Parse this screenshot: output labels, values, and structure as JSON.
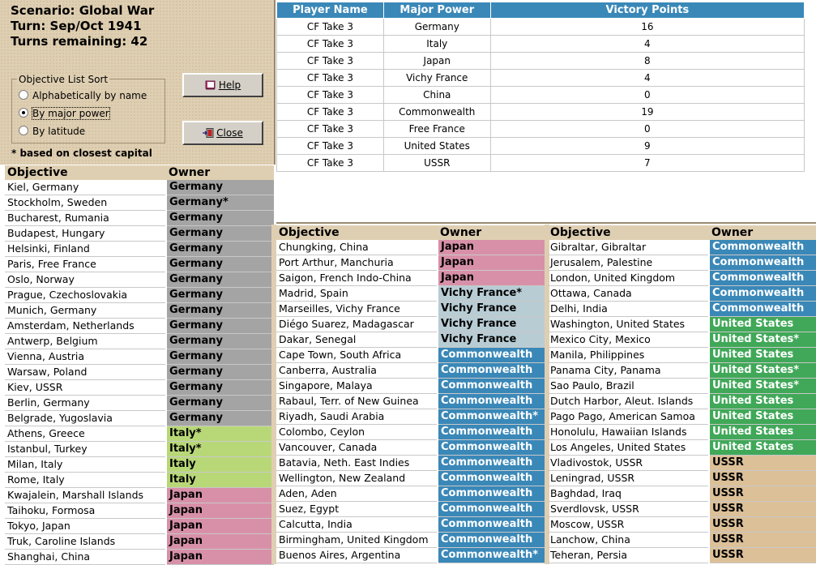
{
  "scenario": {
    "title": "Scenario: Global War",
    "turn": "Turn: Sep/Oct 1941",
    "remaining": "Turns remaining: 42"
  },
  "sort": {
    "legend": "Objective List Sort",
    "options": [
      "Alphabetically by name",
      "By major power",
      "By latitude"
    ],
    "selected": "By major power"
  },
  "buttons": {
    "help_label": "Help",
    "close_label": "Close"
  },
  "footnote": "* based on closest capital",
  "colors": {
    "Germany": "#a4a4a4",
    "Italy": "#b8d878",
    "Japan": "#d890a8",
    "Vichy France": "#b8ccd4",
    "Commonwealth": "#3a88b8",
    "United States": "#40a858",
    "USSR": "#dcc098"
  },
  "vp_table": {
    "headers": [
      "Player Name",
      "Major Power",
      "Victory Points"
    ],
    "rows": [
      [
        "CF Take 3",
        "Germany",
        "16"
      ],
      [
        "CF Take 3",
        "Italy",
        "4"
      ],
      [
        "CF Take 3",
        "Japan",
        "8"
      ],
      [
        "CF Take 3",
        "Vichy France",
        "4"
      ],
      [
        "CF Take 3",
        "China",
        "0"
      ],
      [
        "CF Take 3",
        "Commonwealth",
        "19"
      ],
      [
        "CF Take 3",
        "Free France",
        "0"
      ],
      [
        "CF Take 3",
        "United States",
        "9"
      ],
      [
        "CF Take 3",
        "USSR",
        "7"
      ]
    ]
  },
  "objective_headers": {
    "objective": "Objective",
    "owner": "Owner"
  },
  "col1": [
    [
      "Kiel, Germany",
      "Germany",
      "Germany"
    ],
    [
      "Stockholm, Sweden",
      "Germany*",
      "Germany"
    ],
    [
      "Bucharest, Rumania",
      "Germany",
      "Germany"
    ],
    [
      "Budapest, Hungary",
      "Germany",
      "Germany"
    ],
    [
      "Helsinki, Finland",
      "Germany",
      "Germany"
    ],
    [
      "Paris, Free France",
      "Germany",
      "Germany"
    ],
    [
      "Oslo, Norway",
      "Germany",
      "Germany"
    ],
    [
      "Prague, Czechoslovakia",
      "Germany",
      "Germany"
    ],
    [
      "Munich, Germany",
      "Germany",
      "Germany"
    ],
    [
      "Amsterdam, Netherlands",
      "Germany",
      "Germany"
    ],
    [
      "Antwerp, Belgium",
      "Germany",
      "Germany"
    ],
    [
      "Vienna, Austria",
      "Germany",
      "Germany"
    ],
    [
      "Warsaw, Poland",
      "Germany",
      "Germany"
    ],
    [
      "Kiev, USSR",
      "Germany",
      "Germany"
    ],
    [
      "Berlin, Germany",
      "Germany",
      "Germany"
    ],
    [
      "Belgrade, Yugoslavia",
      "Germany",
      "Germany"
    ],
    [
      "Athens, Greece",
      "Italy*",
      "Italy"
    ],
    [
      "Istanbul, Turkey",
      "Italy*",
      "Italy"
    ],
    [
      "Milan, Italy",
      "Italy",
      "Italy"
    ],
    [
      "Rome, Italy",
      "Italy",
      "Italy"
    ],
    [
      "Kwajalein, Marshall Islands",
      "Japan",
      "Japan"
    ],
    [
      "Taihoku, Formosa",
      "Japan",
      "Japan"
    ],
    [
      "Tokyo, Japan",
      "Japan",
      "Japan"
    ],
    [
      "Truk, Caroline Islands",
      "Japan",
      "Japan"
    ],
    [
      "Shanghai, China",
      "Japan",
      "Japan"
    ]
  ],
  "col2": [
    [
      "Chungking, China",
      "Japan",
      "Japan"
    ],
    [
      "Port Arthur, Manchuria",
      "Japan",
      "Japan"
    ],
    [
      "Saigon, French Indo-China",
      "Japan",
      "Japan"
    ],
    [
      "Madrid, Spain",
      "Vichy France*",
      "Vichy France"
    ],
    [
      "Marseilles, Vichy France",
      "Vichy France",
      "Vichy France"
    ],
    [
      "Diégo Suarez, Madagascar",
      "Vichy France",
      "Vichy France"
    ],
    [
      "Dakar, Senegal",
      "Vichy France",
      "Vichy France"
    ],
    [
      "Cape Town, South Africa",
      "Commonwealth",
      "Commonwealth"
    ],
    [
      "Canberra, Australia",
      "Commonwealth",
      "Commonwealth"
    ],
    [
      "Singapore, Malaya",
      "Commonwealth",
      "Commonwealth"
    ],
    [
      "Rabaul, Terr. of New Guinea",
      "Commonwealth",
      "Commonwealth"
    ],
    [
      "Riyadh, Saudi Arabia",
      "Commonwealth*",
      "Commonwealth"
    ],
    [
      "Colombo, Ceylon",
      "Commonwealth",
      "Commonwealth"
    ],
    [
      "Vancouver, Canada",
      "Commonwealth",
      "Commonwealth"
    ],
    [
      "Batavia, Neth. East Indies",
      "Commonwealth",
      "Commonwealth"
    ],
    [
      "Wellington, New Zealand",
      "Commonwealth",
      "Commonwealth"
    ],
    [
      "Aden, Aden",
      "Commonwealth",
      "Commonwealth"
    ],
    [
      "Suez, Egypt",
      "Commonwealth",
      "Commonwealth"
    ],
    [
      "Calcutta, India",
      "Commonwealth",
      "Commonwealth"
    ],
    [
      "Birmingham, United Kingdom",
      "Commonwealth",
      "Commonwealth"
    ],
    [
      "Buenos Aires, Argentina",
      "Commonwealth*",
      "Commonwealth"
    ]
  ],
  "col3": [
    [
      "Gibraltar, Gibraltar",
      "Commonwealth",
      "Commonwealth"
    ],
    [
      "Jerusalem, Palestine",
      "Commonwealth",
      "Commonwealth"
    ],
    [
      "London, United Kingdom",
      "Commonwealth",
      "Commonwealth"
    ],
    [
      "Ottawa, Canada",
      "Commonwealth",
      "Commonwealth"
    ],
    [
      "Delhi, India",
      "Commonwealth",
      "Commonwealth"
    ],
    [
      "Washington, United States",
      "United States",
      "United States"
    ],
    [
      "Mexico City, Mexico",
      "United States*",
      "United States"
    ],
    [
      "Manila, Philippines",
      "United States",
      "United States"
    ],
    [
      "Panama City, Panama",
      "United States*",
      "United States"
    ],
    [
      "Sao Paulo, Brazil",
      "United States*",
      "United States"
    ],
    [
      "Dutch Harbor, Aleut. Islands",
      "United States",
      "United States"
    ],
    [
      "Pago Pago, American Samoa",
      "United States",
      "United States"
    ],
    [
      "Honolulu, Hawaiian Islands",
      "United States",
      "United States"
    ],
    [
      "Los Angeles, United States",
      "United States",
      "United States"
    ],
    [
      "Vladivostok, USSR",
      "USSR",
      "USSR"
    ],
    [
      "Leningrad, USSR",
      "USSR",
      "USSR"
    ],
    [
      "Baghdad, Iraq",
      "USSR",
      "USSR"
    ],
    [
      "Sverdlovsk, USSR",
      "USSR",
      "USSR"
    ],
    [
      "Moscow, USSR",
      "USSR",
      "USSR"
    ],
    [
      "Lanchow, China",
      "USSR",
      "USSR"
    ],
    [
      "Teheran, Persia",
      "USSR",
      "USSR"
    ]
  ]
}
